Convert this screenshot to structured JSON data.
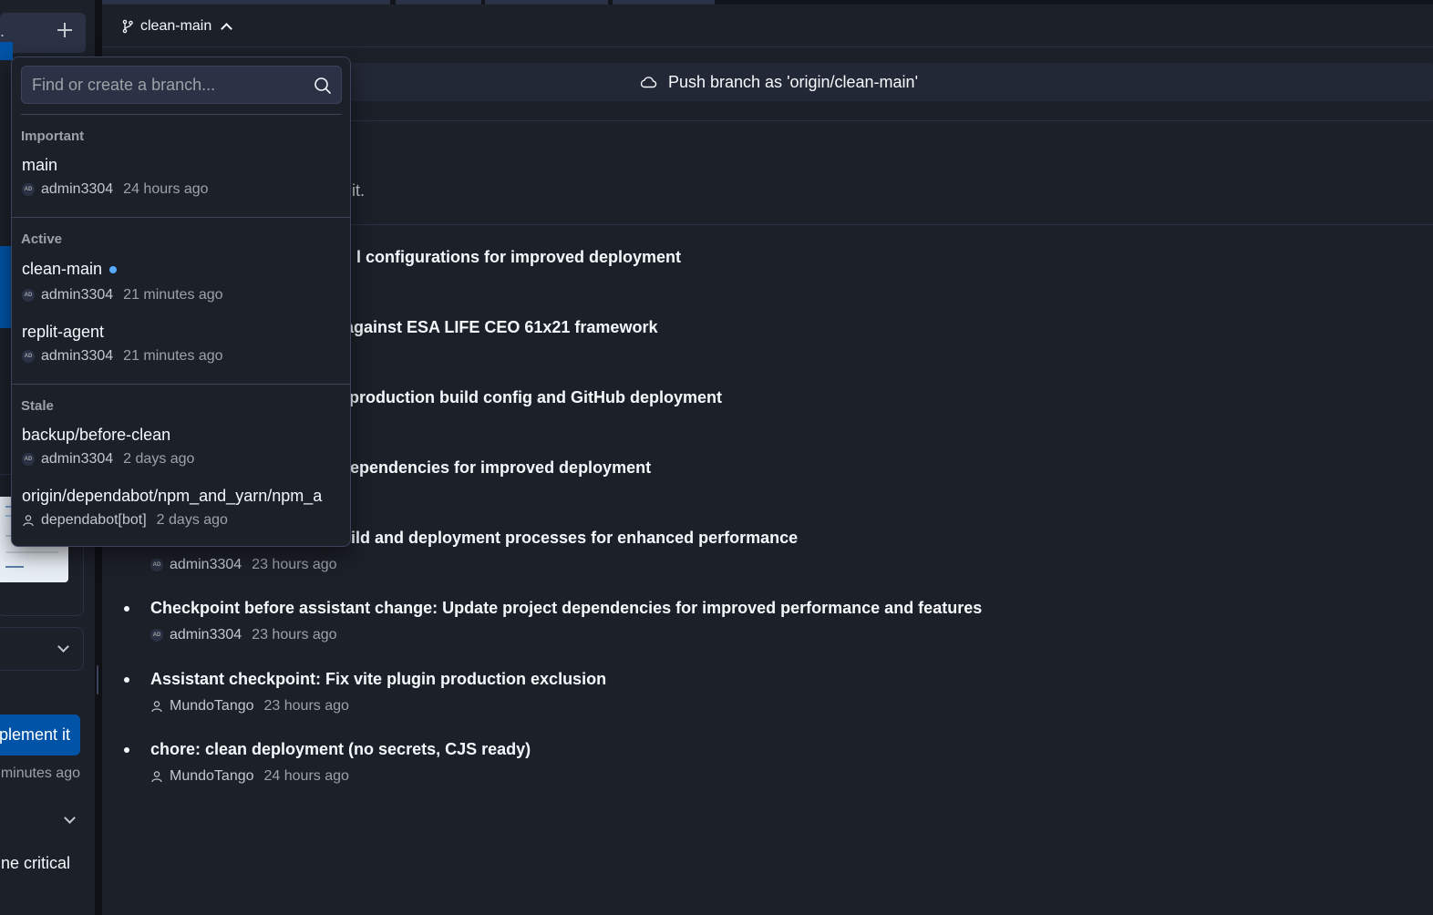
{
  "left_panel": {
    "header_dot": ".",
    "button_label": "plement it",
    "time_label": "minutes ago",
    "text_fragment": "ne critical"
  },
  "topbar": {
    "current_branch": "clean-main"
  },
  "push_bar": {
    "label": "Push branch as 'origin/clean-main'"
  },
  "main": {
    "hidden_fragment": "it."
  },
  "commits": [
    {
      "message": "l configurations for improved deployment",
      "author": "",
      "time": ""
    },
    {
      "message": "against ESA LIFE CEO 61x21 framework",
      "author": "",
      "time": ""
    },
    {
      "message": "production build config and GitHub deployment",
      "author": "",
      "time": ""
    },
    {
      "message": "ependencies for improved deployment",
      "author": "",
      "time": ""
    },
    {
      "message": "ild and deployment processes for enhanced performance",
      "author": "admin3304",
      "time": "23 hours ago"
    },
    {
      "message": "Checkpoint before assistant change: Update project dependencies for improved performance and features",
      "author": "admin3304",
      "time": "23 hours ago"
    },
    {
      "message": "Assistant checkpoint: Fix vite plugin production exclusion",
      "author": "MundoTango",
      "time": "23 hours ago"
    },
    {
      "message": "chore: clean deployment (no secrets, CJS ready)",
      "author": "MundoTango",
      "time": "24 hours ago"
    }
  ],
  "dropdown": {
    "search_placeholder": "Find or create a branch...",
    "sections": {
      "important": "Important",
      "active": "Active",
      "stale": "Stale"
    },
    "branches": [
      {
        "name": "main",
        "author": "admin3304",
        "time": "24 hours ago",
        "avatar": "AD"
      },
      {
        "name": "clean-main",
        "author": "admin3304",
        "time": "21 minutes ago",
        "avatar": "AD",
        "current": true
      },
      {
        "name": "replit-agent",
        "author": "admin3304",
        "time": "21 minutes ago",
        "avatar": "AD"
      },
      {
        "name": "backup/before-clean",
        "author": "admin3304",
        "time": "2 days ago",
        "avatar": "AD"
      },
      {
        "name": "origin/dependabot/npm_and_yarn/npm_a",
        "author": "dependabot[bot]",
        "time": "2 days ago",
        "avatar": "user-icon"
      }
    ]
  },
  "colors": {
    "background": "#1c2029",
    "surface": "#2b3245",
    "accent_blue": "#0053a6",
    "current_dot": "#57abff"
  }
}
